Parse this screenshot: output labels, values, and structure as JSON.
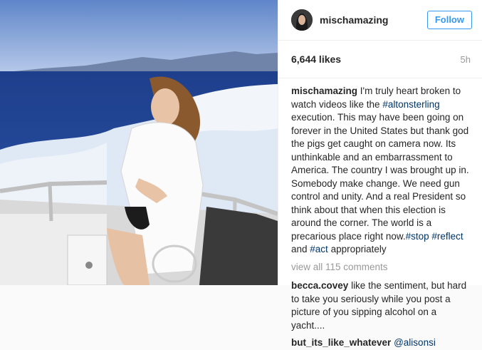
{
  "post": {
    "username": "mischamazing",
    "follow_label": "Follow",
    "likes": "6,644 likes",
    "time": "5h"
  },
  "caption": {
    "username": "mischamazing",
    "part1": " I'm truly heart broken to watch videos like the ",
    "tag1": "#altonsterling",
    "part2": " execution. This may have been going on forever in the United States but thank god the pigs get caught on camera now. Its unthinkable and an embarrassment to America. The country I was brought up in. Somebody make change. We need gun control and unity. And a real President so think about that when this election is around the corner. The world is a precarious place right now.",
    "tag2": "#stop",
    "sp1": " ",
    "tag3": "#reflect",
    "part3": " and ",
    "tag4": "#act",
    "part4": " appropriately"
  },
  "view_all": "view all 115 comments",
  "comments": [
    {
      "username": "becca.covey",
      "text": " like the sentiment, but hard to take you seriously while you post a picture of you sipping alcohol on a yacht...."
    },
    {
      "username": "but_its_like_whatever",
      "mention": "@alisonsi"
    }
  ]
}
